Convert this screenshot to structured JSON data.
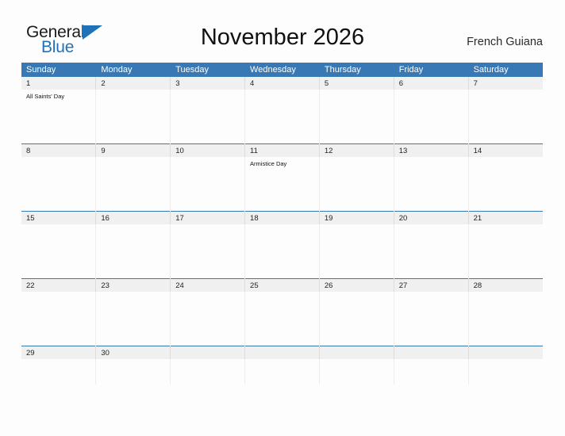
{
  "brand": {
    "name_part1": "General",
    "name_part2": "Blue",
    "flag_icon": "blue-flag-triangle"
  },
  "header": {
    "title": "November 2026",
    "region": "French Guiana"
  },
  "calendar": {
    "month": "November",
    "year": "2026",
    "weekday_headers": [
      "Sunday",
      "Monday",
      "Tuesday",
      "Wednesday",
      "Thursday",
      "Friday",
      "Saturday"
    ],
    "colors": {
      "header_blue": "#3878b4",
      "daynum_strip": "#f0f0f0",
      "logo_blue": "#1f72b8",
      "page_background": "#fdfdfd"
    },
    "weeks": [
      {
        "days": [
          {
            "number": "1",
            "events": [
              "All Saints' Day"
            ]
          },
          {
            "number": "2",
            "events": []
          },
          {
            "number": "3",
            "events": []
          },
          {
            "number": "4",
            "events": []
          },
          {
            "number": "5",
            "events": []
          },
          {
            "number": "6",
            "events": []
          },
          {
            "number": "7",
            "events": []
          }
        ]
      },
      {
        "days": [
          {
            "number": "8",
            "events": []
          },
          {
            "number": "9",
            "events": []
          },
          {
            "number": "10",
            "events": []
          },
          {
            "number": "11",
            "events": [
              "Armistice Day"
            ]
          },
          {
            "number": "12",
            "events": []
          },
          {
            "number": "13",
            "events": []
          },
          {
            "number": "14",
            "events": []
          }
        ]
      },
      {
        "days": [
          {
            "number": "15",
            "events": []
          },
          {
            "number": "16",
            "events": []
          },
          {
            "number": "17",
            "events": []
          },
          {
            "number": "18",
            "events": []
          },
          {
            "number": "19",
            "events": []
          },
          {
            "number": "20",
            "events": []
          },
          {
            "number": "21",
            "events": []
          }
        ]
      },
      {
        "days": [
          {
            "number": "22",
            "events": []
          },
          {
            "number": "23",
            "events": []
          },
          {
            "number": "24",
            "events": []
          },
          {
            "number": "25",
            "events": []
          },
          {
            "number": "26",
            "events": []
          },
          {
            "number": "27",
            "events": []
          },
          {
            "number": "28",
            "events": []
          }
        ]
      },
      {
        "days": [
          {
            "number": "29",
            "events": []
          },
          {
            "number": "30",
            "events": []
          },
          {
            "number": "",
            "events": []
          },
          {
            "number": "",
            "events": []
          },
          {
            "number": "",
            "events": []
          },
          {
            "number": "",
            "events": []
          },
          {
            "number": "",
            "events": []
          }
        ]
      }
    ]
  }
}
